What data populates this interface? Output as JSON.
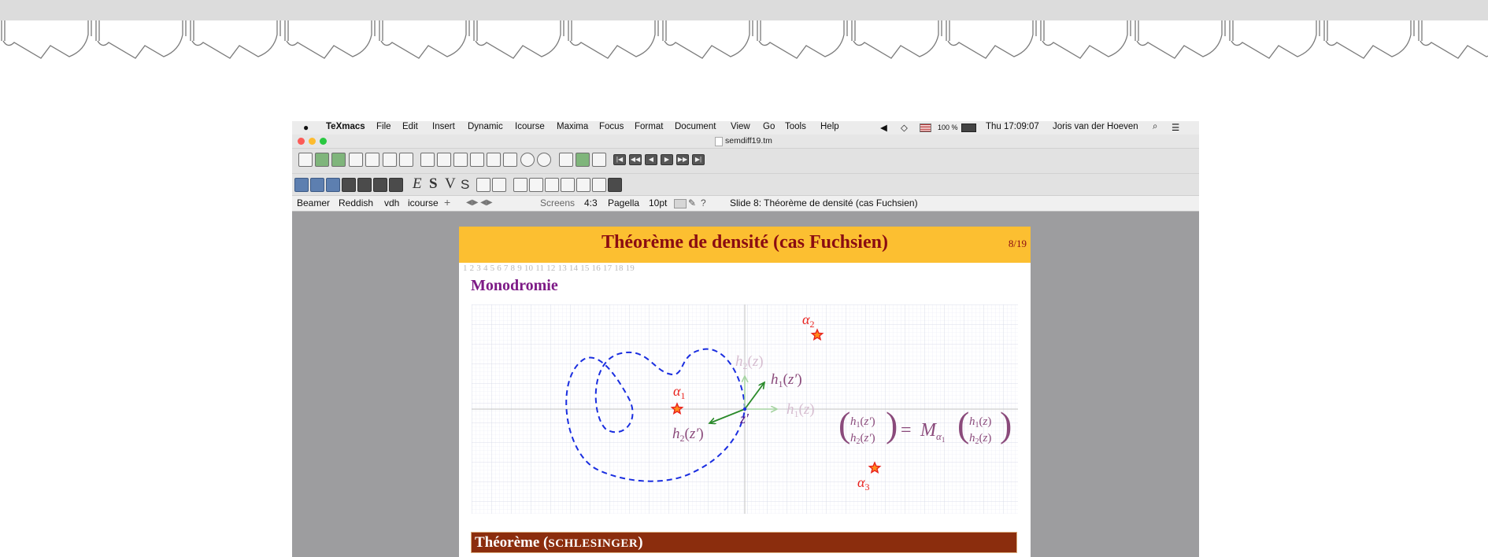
{
  "menubar": {
    "app": "TeXmacs",
    "items": [
      "File",
      "Edit",
      "Insert",
      "Dynamic",
      "Icourse",
      "Maxima",
      "Focus",
      "Format",
      "Document",
      "View",
      "Go",
      "Tools",
      "Help"
    ],
    "battery": "100 %",
    "clock": "Thu 17:09:07",
    "user": "Joris van der Hoeven"
  },
  "window": {
    "filename": "semdiff19.tm"
  },
  "font_buttons": [
    "E",
    "S",
    "V",
    "S"
  ],
  "format_bar": {
    "items": [
      "Beamer",
      "Reddish",
      "vdh",
      "icourse"
    ],
    "screens": "Screens",
    "ratio": "4:3",
    "font": "Pagella",
    "size": "10pt",
    "help": "?",
    "slide": "Slide 8: Théorème de densité (cas Fuchsien)"
  },
  "slide": {
    "title": "Théorème de densité (cas Fuchsien)",
    "counter": "8/19",
    "page_numbers": "1 2 3 4 5 6 7 8 9 10 11 12 13 14 15 16 17 18 19",
    "section": "Monodromie",
    "theorem_head": "Théorème (",
    "theorem_name": "Schlesinger",
    "theorem_tail": ")"
  },
  "figure": {
    "singularities": [
      "α1",
      "α2",
      "α3"
    ],
    "vector_labels": {
      "h1z": "h1(z)",
      "h2z": "h2(z)",
      "h1zp": "h1(z′)",
      "h2zp": "h2(z′)",
      "zp": "z′"
    },
    "matrix_relation": "(h1(z′), h2(z′)) = Mα1 (h1(z), h2(z))"
  },
  "colors": {
    "slide_header": "#fcbf31",
    "title": "#8a0c12",
    "section": "#7d1a86",
    "loop": "#1a2ee0",
    "star": "#e8211d",
    "arrow_new": "#2a8a2a",
    "theorem_bar": "#8b2d0d"
  }
}
